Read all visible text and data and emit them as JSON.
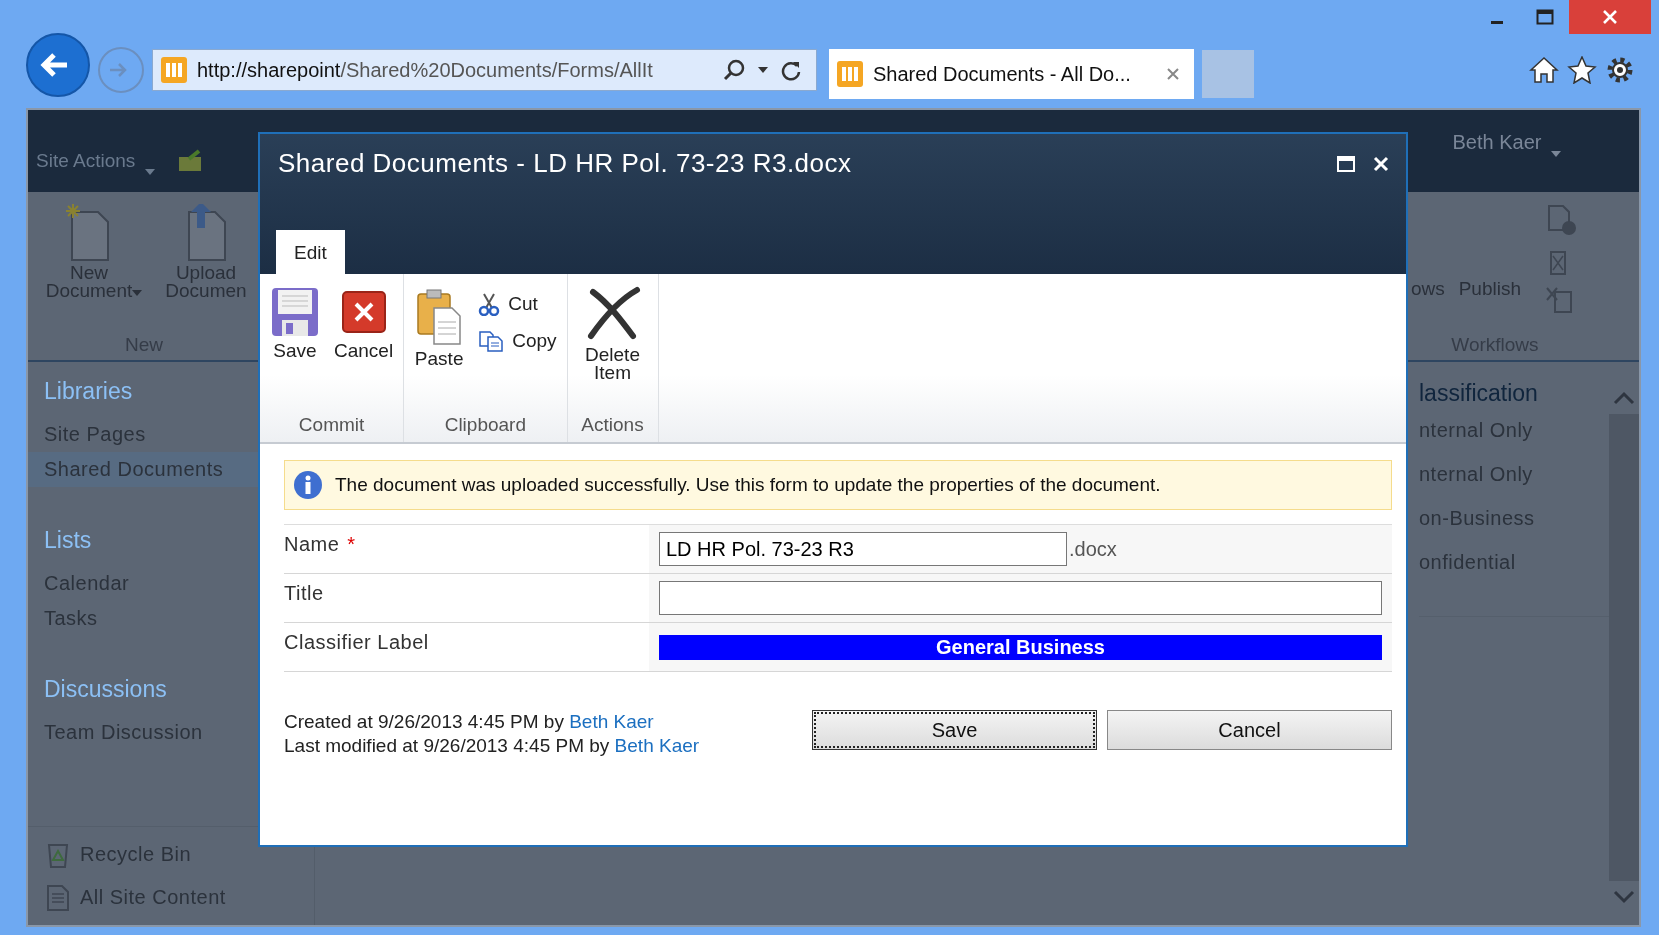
{
  "browser": {
    "address_host": "http://sharepoint",
    "address_path": "/Shared%20Documents/Forms/AllIt",
    "tab_title": "Shared Documents - All Do..."
  },
  "page": {
    "site_actions": "Site Actions",
    "user": "Beth Kaer",
    "ribbon_left": {
      "buttons": [
        {
          "label": "New Document",
          "dropdown": true,
          "kind": "new"
        },
        {
          "label": "Upload Documen",
          "dropdown": false,
          "kind": "upload"
        }
      ],
      "group": "New"
    },
    "ribbon_right": {
      "buttons": [
        "ows",
        "Publish"
      ],
      "group": "Workflows"
    },
    "nav": [
      {
        "heading": "Libraries",
        "items": [
          {
            "label": "Site Pages",
            "selected": false
          },
          {
            "label": "Shared Documents",
            "selected": true
          }
        ]
      },
      {
        "heading": "Lists",
        "items": [
          {
            "label": "Calendar",
            "selected": false
          },
          {
            "label": "Tasks",
            "selected": false
          }
        ]
      },
      {
        "heading": "Discussions",
        "items": [
          {
            "label": "Team Discussion",
            "selected": false
          }
        ]
      }
    ],
    "nav_footer": [
      {
        "kind": "recycle",
        "label": "Recycle Bin"
      },
      {
        "kind": "content",
        "label": "All Site Content"
      }
    ],
    "classification": {
      "heading": "lassification",
      "items": [
        "nternal Only",
        "nternal Only",
        "on-Business",
        "onfidential"
      ]
    }
  },
  "dialog": {
    "title": "Shared Documents - LD HR Pol. 73-23 R3.docx",
    "tabs": [
      {
        "label": "Edit",
        "selected": true
      }
    ],
    "ribbon_groups": [
      {
        "label": "Commit",
        "buttons": [
          {
            "kind": "save",
            "label": "Save"
          },
          {
            "kind": "cancel",
            "label": "Cancel"
          }
        ]
      },
      {
        "label": "Clipboard",
        "buttons": [
          {
            "kind": "paste",
            "label": "Paste"
          },
          {
            "kind": "cut",
            "label": "Cut"
          },
          {
            "kind": "copy",
            "label": "Copy"
          }
        ]
      },
      {
        "label": "Actions",
        "buttons": [
          {
            "kind": "delete",
            "label": "Delete Item"
          }
        ]
      }
    ],
    "message": "The document was uploaded successfully. Use this form to update the properties of the document.",
    "fields": [
      {
        "kind": "text",
        "label": "Name",
        "required_mark": "*",
        "value": "LD HR Pol. 73-23 R3",
        "suffix": ".docx"
      },
      {
        "kind": "text",
        "label": "Title"
      },
      {
        "kind": "label",
        "label": "Classifier Label",
        "value": "General Business"
      }
    ],
    "created": {
      "text": "Created at 9/26/2013 4:45 PM by",
      "user": "Beth Kaer"
    },
    "modified": {
      "text": "Last modified at 9/26/2013 4:45 PM by",
      "user": "Beth Kaer"
    },
    "buttons": [
      {
        "label": "Save",
        "focused": true
      },
      {
        "label": "Cancel",
        "focused": false
      }
    ]
  }
}
